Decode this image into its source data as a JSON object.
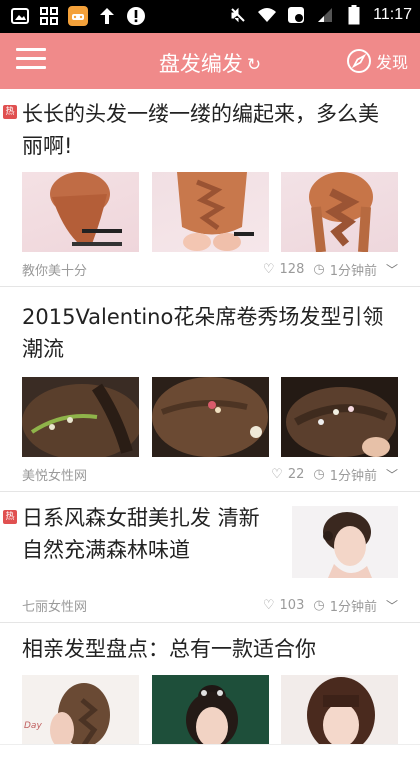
{
  "status_bar": {
    "time": "11:17",
    "left_icons": [
      "image-icon",
      "app-grid-icon",
      "game-controller-icon",
      "upload-arrow-icon",
      "alert-icon"
    ],
    "right_icons": [
      "mute-icon",
      "wifi-icon",
      "data-saver-icon",
      "signal-icon",
      "battery-icon"
    ]
  },
  "header": {
    "title": "盘发编发",
    "discover_label": "发现",
    "bg_color": "#f08a8a"
  },
  "articles": [
    {
      "hot": true,
      "hot_label": "热",
      "title": "长长的头发一缕一缕的编起来，多么美丽啊!",
      "source": "教你美十分",
      "likes": "128",
      "time": "1分钟前",
      "images": [
        "braid-photo",
        "braid-photo",
        "braid-photo"
      ]
    },
    {
      "hot": false,
      "title": "2015Valentino花朵席卷秀场发型引领潮流",
      "source": "美悦女性网",
      "likes": "22",
      "time": "1分钟前",
      "images": [
        "flower-hair-photo",
        "flower-hair-photo",
        "flower-hair-photo"
      ]
    },
    {
      "hot": true,
      "hot_label": "热",
      "title": "日系风森女甜美扎发 清新自然充满森林味道",
      "source": "七丽女性网",
      "likes": "103",
      "time": "1分钟前",
      "images": [
        "updo-photo"
      ]
    },
    {
      "hot": false,
      "title": "相亲发型盘点：总有一款适合你",
      "images": [
        "hairstyle-photo",
        "hairstyle-photo",
        "hairstyle-photo"
      ],
      "img1_caption": "Day"
    }
  ]
}
